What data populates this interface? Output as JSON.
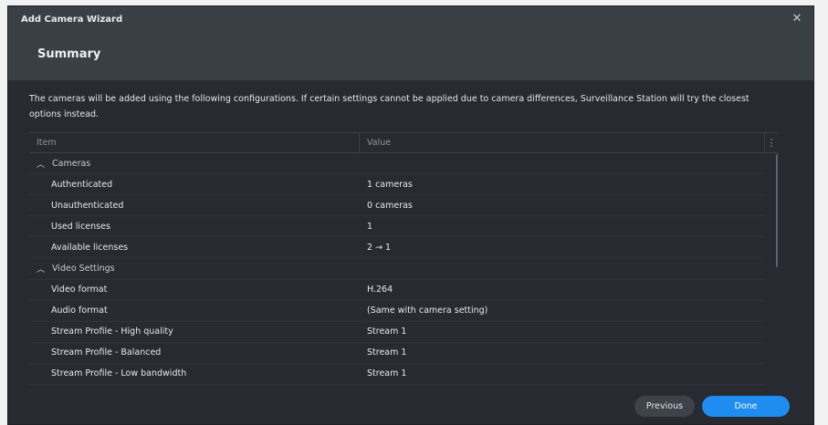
{
  "window": {
    "title": "Add Camera Wizard",
    "close_glyph": "✕"
  },
  "header": {
    "heading": "Summary"
  },
  "description": "The cameras will be added using the following configurations. If certain settings cannot be applied due to camera differences, Surveillance Station will try the closest options instead.",
  "table": {
    "columns": {
      "item": "Item",
      "value": "Value",
      "menu": "⋮"
    },
    "groups": [
      {
        "label": "Cameras",
        "rows": [
          {
            "item": "Authenticated",
            "value": "1 cameras"
          },
          {
            "item": "Unauthenticated",
            "value": "0 cameras"
          },
          {
            "item": "Used licenses",
            "value": "1"
          },
          {
            "item": "Available licenses",
            "value": "2 → 1"
          }
        ]
      },
      {
        "label": "Video Settings",
        "rows": [
          {
            "item": "Video format",
            "value": "H.264"
          },
          {
            "item": "Audio format",
            "value": "(Same with camera setting)"
          },
          {
            "item": "Stream Profile - High quality",
            "value": "Stream 1"
          },
          {
            "item": "Stream Profile - Balanced",
            "value": "Stream 1"
          },
          {
            "item": "Stream Profile - Low bandwidth",
            "value": "Stream 1"
          }
        ]
      }
    ]
  },
  "buttons": {
    "previous": "Previous",
    "done": "Done"
  },
  "colors": {
    "accent": "#1e8cf0",
    "panel": "#272b31",
    "header": "#3a3f46"
  },
  "icons": {
    "close": "close-icon",
    "collapse": "chevron-up-icon",
    "column_menu": "more-vertical-icon"
  }
}
